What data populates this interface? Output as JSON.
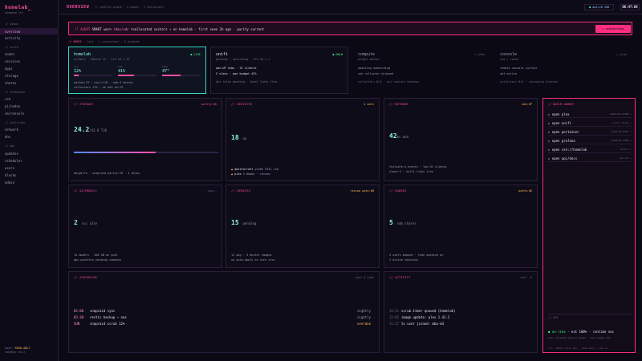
{
  "sidebar": {
    "brand": "homelab_",
    "brand_sub": "command ctr",
    "sections": [
      {
        "title": "// views",
        "items": [
          "overview",
          "activity"
        ]
      },
      {
        "title": "// infra",
        "items": [
          "nodes",
          "services",
          "apps",
          "storage",
          "shares"
        ]
      },
      {
        "title": "// terminals",
        "items": [
          "ssh",
          "pi/nodes",
          "vm/console"
        ]
      },
      {
        "title": "// utilities",
        "items": [
          "network",
          "dns"
        ]
      },
      {
        "title": "// api",
        "items": [
          "updates",
          "scheduler",
          "users",
          "blocks",
          "admin"
        ]
      }
    ],
    "footer": {
      "prefix": "mode:",
      "mode": "READ-ONLY",
      "version": "lab@hpc v0.2"
    }
  },
  "topbar": {
    "title": "OVERVIEW",
    "crumb": "// control plane · 4 nodes · 7 collectors",
    "status_dot": "●",
    "status": "api/v0 200",
    "clock": "06:47:08"
  },
  "alert": {
    "tag": "!! ALERT",
    "text_a": "SMART warn",
    "device": "/dev/sdc",
    "text_b": "reallocated sectors ↑ on homelab · first seen 2h ago · parity current",
    "button": "▸ acknowledge"
  },
  "nodes_header": {
    "key": "// NODES",
    "rest": "· list · 1 consistent · 3 planned"
  },
  "nodes": [
    {
      "name": "homelab",
      "state": "● LIVE",
      "role": "primary · debian 12 · 172.16.1.12",
      "stats": [
        {
          "label": "cpu",
          "value": "12%",
          "fill": 0.12
        },
        {
          "label": "mem",
          "value": "41%",
          "fill": 0.41
        },
        {
          "label": "temp",
          "value": "47°",
          "fill": 0.47
        }
      ],
      "line1": "uptime:19 · ssd:/r18 · smb:3 shares",
      "line2": "collectors 17d · ok 6d3 hh:23"
    },
    {
      "name": "unifi",
      "state": "● ONLN",
      "role": "gateway · switching · 172.16.1.1",
      "line1": "wan:UP 41ms · 31 clients",
      "line2": "3 vlans · poe budget 43%",
      "line3": "dpi rules pending · ideal links flow"
    },
    {
      "name": "compute",
      "state": "○ plan",
      "role": "plight marker",
      "line1": "awaiting onboarding",
      "line2": "ssh collector planned",
      "line3": "collectors N/A · pii capture unknown"
    },
    {
      "name": "console",
      "state": "○ plan",
      "role": "tim / route",
      "line1": "remote console surface",
      "line2": "not active",
      "line3": "collectors N/A · consuming planned"
    }
  ],
  "cards": {
    "storage": {
      "title": "// STORAGE",
      "meta": "parity:OK",
      "big": "24.2",
      "unit": "/42.8 TiB",
      "fill": 0.565,
      "footer": "mergerfs · snapraid parity:10 · 4 disks"
    },
    "services": {
      "title": "// SERVICES",
      "meta": "2 warn",
      "big": "18",
      "unit": "up",
      "l1a": "▲ ",
      "l1b": "qbittorrent",
      "l1c": " probe FAIL 11m",
      "l2a": "▲ ",
      "l2b": "plex",
      "l2c": " 3 dmods · review"
    },
    "network": {
      "title": "// NETWORK",
      "meta": "wan:UP",
      "big": "42",
      "unit": "ms wan",
      "l1": "failsafe:4 events · lan:31 clients",
      "l2": "vlans:3 · unifi links live"
    },
    "ai_models": {
      "title": "// AI/MODELS",
      "meta": "gpu:—",
      "big": "2",
      "unit": "svc idle",
      "l1": "14 models · 388 GB on pool",
      "l2": "gpu passthru pending compute"
    },
    "updates": {
      "title": "// UPDATES",
      "meta": "review gate:0B",
      "big": "15",
      "unit": "pending",
      "l1": "11 pkg · 3 docker images",
      "l2": "no auto-apply on core svcs"
    },
    "shares": {
      "title": "// SHARES",
      "meta": "paths:OK",
      "big": "5",
      "unit": "smb shares",
      "l1": "3 users mapped · time machine on",
      "l2": "2 active sessions"
    }
  },
  "quick_launch": {
    "title": "// QUICK LAUNCH",
    "items": [
      {
        "label": "▸ open plex",
        "hint": "homelab:32400 ↗"
      },
      {
        "label": "▸ open unifi",
        "hint": "unifi local ↗"
      },
      {
        "label": "▸ open portainer",
        "hint": "homelab:9443 ↗"
      },
      {
        "label": "▸ open grafana",
        "hint": "homelab:3000 ↗"
      },
      {
        "label": "▸ open ssh://homelab",
        "hint": "term:1 ↗"
      },
      {
        "label": "▸ open api/docs",
        "hint": "api/v0 ↗"
      }
    ],
    "api_title": "// API",
    "online_dot": "●",
    "online_a": "on-line",
    "online_b": " · ext 100% · runtime nas",
    "api_l1": "auto unhidden policy armed · last sweep 24s",
    "api_l2": "cli: admin lists ssh · read-only · see ls"
  },
  "scheduler": {
    "title": "// SCHEDULER",
    "meta": "next 4 jobs",
    "rows": [
      {
        "time": "02:00",
        "name": "snapraid sync",
        "freq": "nightly"
      },
      {
        "time": "03:30",
        "name": "restic backup → nas",
        "freq": "nightly"
      },
      {
        "time": "SUN",
        "name": "snapraid scrub 12%",
        "freq": "overdue"
      }
    ]
  },
  "activity": {
    "title": "// ACTIVITY",
    "meta": "tail -5",
    "rows": [
      {
        "time": "14:21",
        "text": "scrub.timer queued (homelab)"
      },
      {
        "time": "13:02",
        "text": "image update: plex 1.41.2"
      },
      {
        "time": "11:17",
        "text": "tv user joined: mba-m3"
      }
    ]
  }
}
